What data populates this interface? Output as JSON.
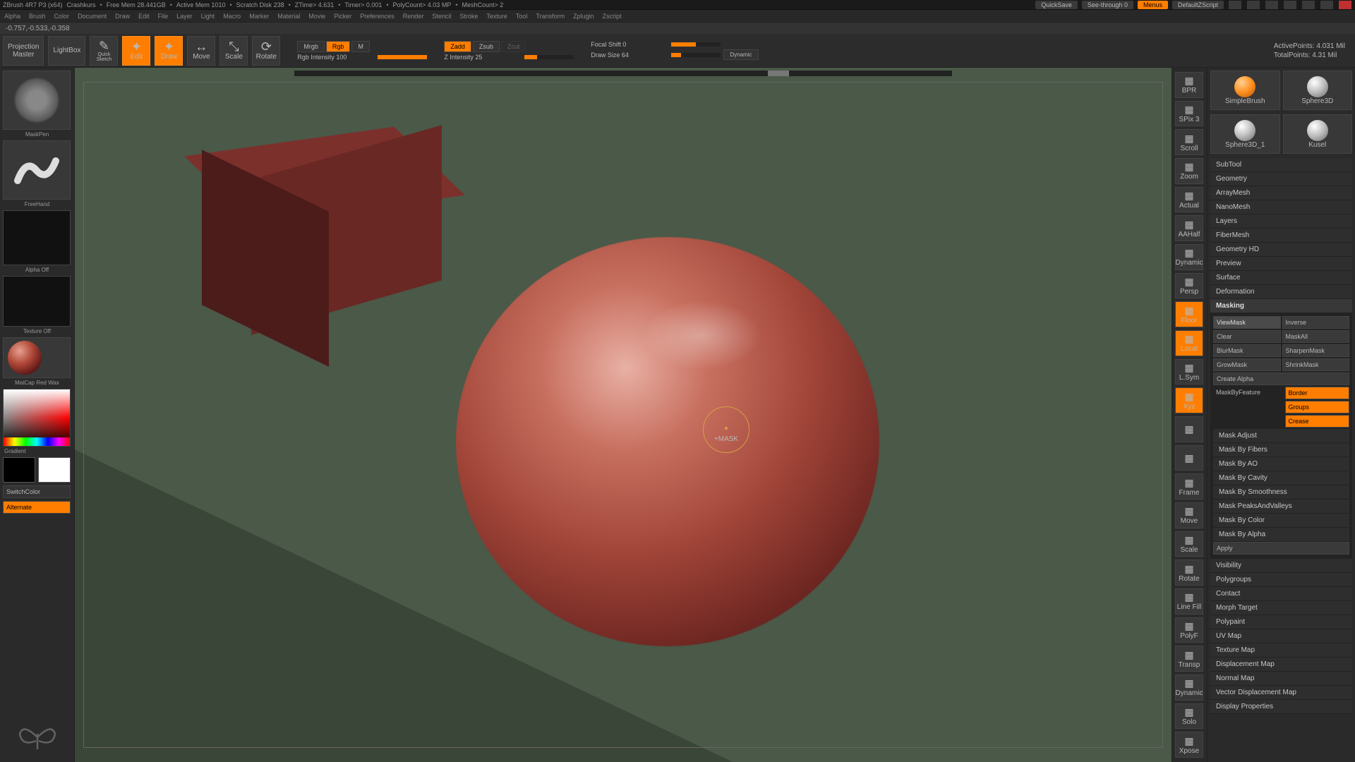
{
  "titlebar": {
    "app": "ZBrush 4R7 P3 (x64)",
    "doc": "Crashkurs",
    "stats": [
      "Free Mem 28.441GB",
      "Active Mem 1010",
      "Scratch Disk 238",
      "ZTime> 4.631",
      "Timer> 0.001",
      "PolyCount> 4.03 MP",
      "MeshCount> 2"
    ],
    "quicksave": "QuickSave",
    "seethrough": "See-through  0",
    "menus": "Menus",
    "script": "DefaultZScript"
  },
  "menubar": [
    "Alpha",
    "Brush",
    "Color",
    "Document",
    "Draw",
    "Edit",
    "File",
    "Layer",
    "Light",
    "Macro",
    "Marker",
    "Material",
    "Movie",
    "Picker",
    "Preferences",
    "Render",
    "Stencil",
    "Stroke",
    "Texture",
    "Tool",
    "Transform",
    "Zplugin",
    "Zscript"
  ],
  "infoline": "-0.757,-0.533,-0.358",
  "shelf": {
    "projection": "Projection\nMaster",
    "lightbox": "LightBox",
    "quicksketch": "Quick\nSketch",
    "edit": "Edit",
    "draw": "Draw",
    "move": "Move",
    "scale": "Scale",
    "rotate": "Rotate",
    "mrgb": "Mrgb",
    "rgb": "Rgb",
    "m": "M",
    "rgb_intensity": "Rgb Intensity 100",
    "zadd": "Zadd",
    "zsub": "Zsub",
    "zcut": "Zcut",
    "z_intensity": "Z Intensity 25",
    "focalshift": "Focal Shift 0",
    "drawsize": "Draw Size 64",
    "dynamic": "Dynamic",
    "activepts": "ActivePoints: 4.031 Mil",
    "totalpts": "TotalPoints: 4.31 Mil"
  },
  "left": {
    "brush": "MaskPen",
    "stroke": "FreeHand",
    "alpha": "Alpha Off",
    "texture": "Texture Off",
    "material": "MatCap Red Wax",
    "gradient": "Gradient",
    "switch": "SwitchColor",
    "alternate": "Alternate"
  },
  "cursor_hint": "+MASK",
  "righticons": [
    "BPR",
    "SPix 3",
    "Scroll",
    "Zoom",
    "Actual",
    "AAHalf",
    "Dynamic",
    "Persp",
    "Floor",
    "Local",
    "L.Sym",
    "Xyz",
    "",
    "",
    "Frame",
    "Move",
    "Scale",
    "Rotate",
    "Line Fill",
    "PolyF",
    "Transp",
    "Dynamic",
    "Solo",
    "Xpose"
  ],
  "righticons_active": {
    "Floor": true,
    "Local": true,
    "Xyz": true
  },
  "thumbs": [
    "SimpleBrush",
    "Sphere3D",
    "Sphere3D_1",
    "Kusel"
  ],
  "palettes_top": [
    "SubTool",
    "Geometry",
    "ArrayMesh",
    "NanoMesh",
    "Layers",
    "FiberMesh",
    "Geometry HD",
    "Preview",
    "Surface",
    "Deformation"
  ],
  "masking": {
    "title": "Masking",
    "viewmask": "ViewMask",
    "inverse": "Inverse",
    "clear": "Clear",
    "maskall": "MaskAll",
    "blurmask": "BlurMask",
    "sharpenmask": "SharpenMask",
    "growmask": "GrowMask",
    "shrinkmask": "ShrinkMask",
    "createalpha": "Create Alpha",
    "maskbyfeature": "MaskByFeature",
    "border": "Border",
    "groups": "Groups",
    "crease": "Crease",
    "maskadjust": "Mask Adjust",
    "fibers": "Mask By Fibers",
    "ao": "Mask By AO",
    "cavity": "Mask By Cavity",
    "smooth": "Mask By Smoothness",
    "peaks": "Mask PeaksAndValleys",
    "color": "Mask By Color",
    "alpha": "Mask By Alpha",
    "apply": "Apply"
  },
  "palettes_bottom": [
    "Visibility",
    "Polygroups",
    "Contact",
    "Morph Target",
    "Polypaint",
    "UV Map",
    "Texture Map",
    "Displacement Map",
    "Normal Map",
    "Vector Displacement Map",
    "Display Properties"
  ]
}
